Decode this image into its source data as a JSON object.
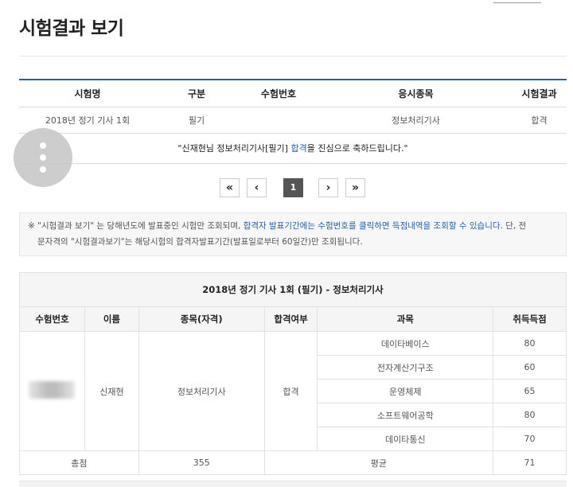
{
  "page": {
    "title": "시험결과 보기"
  },
  "results": {
    "headers": [
      "시험명",
      "구분",
      "수험번호",
      "응시종목",
      "시험결과"
    ],
    "row": {
      "exam": "2018년 정기 기사 1회",
      "type": "필기",
      "number": "",
      "field": "정보처리기사",
      "result": "합격"
    },
    "message": {
      "pre": "\"신재현님 정보처리기사[필기] ",
      "highlight": "합격",
      "post": "을 진심으로 축하드립니다.\""
    }
  },
  "pagination": {
    "first": "«",
    "prev": "‹",
    "current": "1",
    "next": "›",
    "last": "»"
  },
  "notice": {
    "part1": "※ \"시험결과 보기\" 는 당해년도에 발표중인 시험만 조회되며, ",
    "highlight": "합격자 발표기간에는 수험번호를 클릭하면 득점내역을 조회할 수 있습니다.",
    "part2": " 단, 전",
    "line2": "문자격의 \"시험결과보기\"는 해당시험의 합격자발표기간(발표일로부터 60일간)만 조회됩니다."
  },
  "detail": {
    "caption": "2018년 정기 기사 1회 (필기) - 정보처리기사",
    "headers": [
      "수험번호",
      "이름",
      "종목(자격)",
      "합격여부",
      "과목",
      "취득득점"
    ],
    "name": "신재현",
    "field": "정보처리기사",
    "pass": "합격",
    "subjects": [
      {
        "name": "데이타베이스",
        "score": "80"
      },
      {
        "name": "전자계산기구조",
        "score": "60"
      },
      {
        "name": "운영체제",
        "score": "65"
      },
      {
        "name": "소프트웨어공학",
        "score": "80"
      },
      {
        "name": "데이타통신",
        "score": "70"
      }
    ],
    "total_label": "총점",
    "total": "355",
    "avg_label": "평균",
    "avg": "71"
  }
}
